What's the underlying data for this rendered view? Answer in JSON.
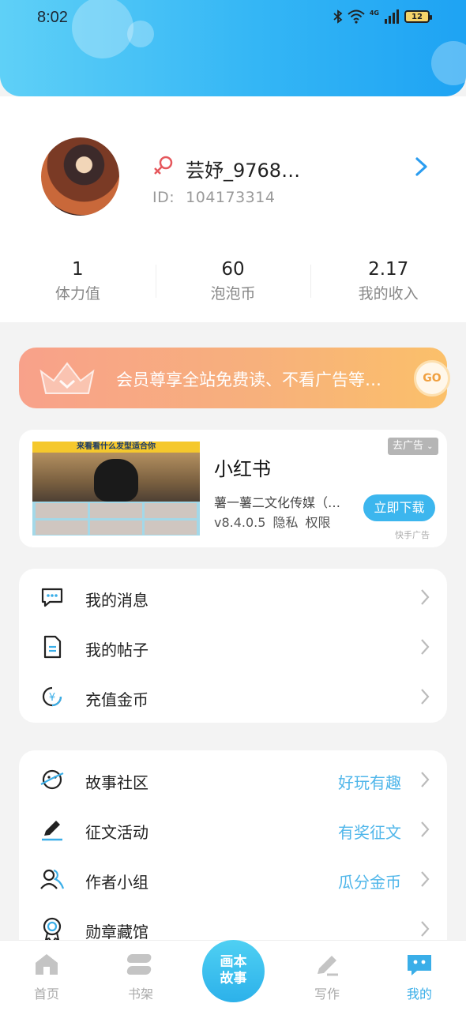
{
  "status_bar": {
    "time": "8:02",
    "battery": "12",
    "network": "4G"
  },
  "profile": {
    "username": "芸妤_9768…",
    "id_label": "ID:",
    "id_value": "104173314",
    "stats": [
      {
        "value": "1",
        "label": "体力值"
      },
      {
        "value": "60",
        "label": "泡泡币"
      },
      {
        "value": "2.17",
        "label": "我的收入"
      }
    ]
  },
  "vip_banner": {
    "text": "会员尊享全站免费读、不看广告等…",
    "go": "GO"
  },
  "ad": {
    "image_banner_text": "来看看什么发型适合你",
    "title": "小红书",
    "company": "薯一薯二文化传媒（…",
    "version": "v8.4.0.5",
    "privacy": "隐私",
    "permission": "权限",
    "tag": "去广告",
    "button": "立即下载",
    "source": "快手广告"
  },
  "menu_group_1": [
    {
      "icon": "message-icon",
      "label": "我的消息"
    },
    {
      "icon": "document-icon",
      "label": "我的帖子"
    },
    {
      "icon": "yuan-coin-icon",
      "label": "充值金币"
    }
  ],
  "menu_group_2": [
    {
      "icon": "planet-icon",
      "label": "故事社区",
      "extra": "好玩有趣"
    },
    {
      "icon": "pen-icon",
      "label": "征文活动",
      "extra": "有奖征文"
    },
    {
      "icon": "users-icon",
      "label": "作者小组",
      "extra": "瓜分金币"
    },
    {
      "icon": "medal-icon",
      "label": "勋章藏馆",
      "extra": ""
    }
  ],
  "bottom_nav": {
    "tabs": [
      {
        "icon": "home-icon",
        "label": "首页"
      },
      {
        "icon": "bookshelf-icon",
        "label": "书架"
      },
      {
        "icon": "write-icon",
        "label": "写作"
      },
      {
        "icon": "mine-icon",
        "label": "我的"
      }
    ],
    "center_line1": "画本",
    "center_line2": "故事",
    "active": "我的"
  },
  "colors": {
    "accent": "#3aaee8",
    "header_start": "#5fd0f7",
    "header_end": "#1ea3f3",
    "vip_start": "#f8a18a",
    "vip_end": "#fbc06a"
  }
}
